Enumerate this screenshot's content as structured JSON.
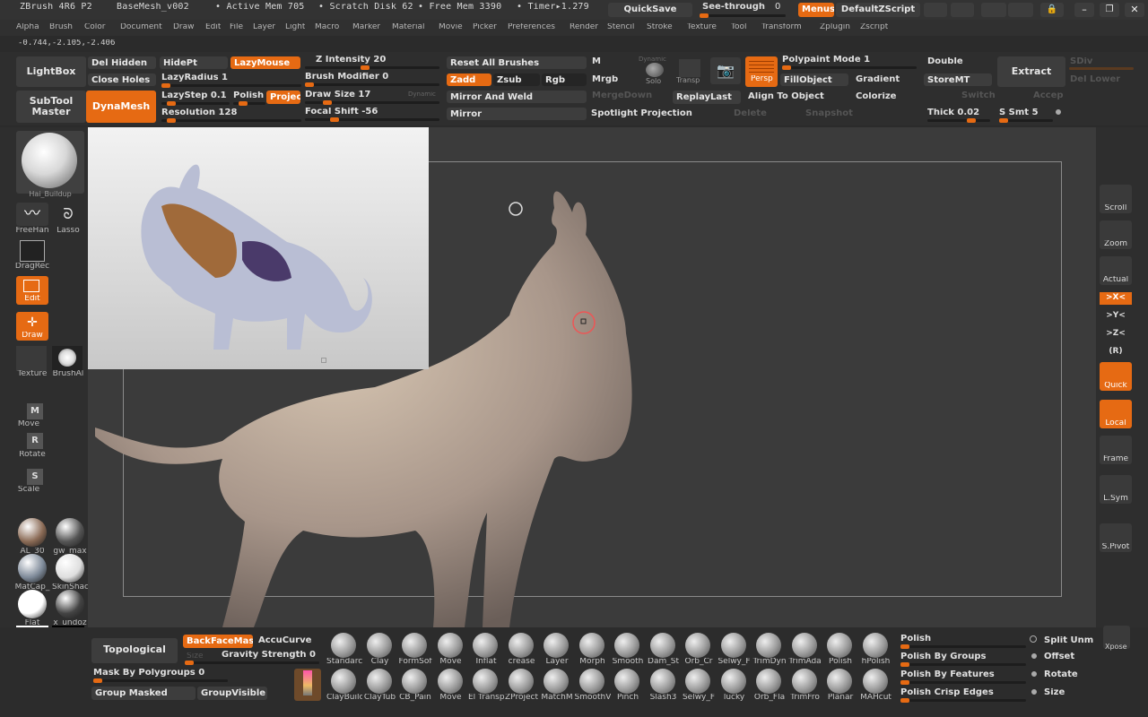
{
  "title_bar": {
    "app": "ZBrush 4R6 P2",
    "doc": "BaseMesh_v002",
    "active_mem": "• Active Mem 705",
    "scratch": "• Scratch Disk 62",
    "free_mem": "• Free Mem 3390",
    "timer": "• Timer▸1.279",
    "quicksave": "QuickSave",
    "see_through": "See-through",
    "see_through_val": "0",
    "menus": "Menus",
    "default_zscript": "DefaultZScript"
  },
  "menu_items": [
    "Alpha",
    "Brush",
    "Color",
    "Document",
    "Draw",
    "Edit",
    "File",
    "Layer",
    "Light",
    "Macro",
    "Marker",
    "Material",
    "Movie",
    "Picker",
    "Preferences",
    "Render",
    "Stencil",
    "Stroke",
    "Texture",
    "Tool",
    "Transform",
    "Zplugin",
    "Zscript"
  ],
  "coords": "-0.744,-2.105,-2.406",
  "toolbar": {
    "lightbox": "LightBox",
    "subtool_master": "SubTool Master",
    "del_hidden": "Del Hidden",
    "close_holes": "Close Holes",
    "dynamesh": "DynaMesh",
    "hidept": "HidePt",
    "lazymouse": "LazyMouse",
    "lazyradius": "LazyRadius 1",
    "lazystep": "LazyStep 0.1",
    "polish": "Polish",
    "project": "Projec",
    "resolution": "Resolution 128",
    "z_intensity": "Z Intensity 20",
    "brush_modifier": "Brush Modifier 0",
    "draw_size": "Draw Size 17",
    "dynamic": "Dynamic",
    "focal_shift": "Focal Shift -56",
    "reset_brushes": "Reset All Brushes",
    "zadd": "Zadd",
    "zsub": "Zsub",
    "rgb": "Rgb",
    "mirror_weld": "Mirror And Weld",
    "mirror": "Mirror",
    "m": "M",
    "mrgb": "Mrgb",
    "solo_dynamic": "Dynamic",
    "solo": "Solo",
    "transp": "Transp",
    "persp": "Persp",
    "mergedown": "MergeDown",
    "replaylast": "ReplayLast",
    "spotlight": "Spotlight Projection",
    "delete": "Delete",
    "snapshot": "Snapshot",
    "polypaint_mode": "Polypaint Mode 1",
    "fillobject": "FillObject",
    "gradient": "Gradient",
    "align_object": "Align To Object",
    "colorize": "Colorize",
    "double": "Double",
    "storemt": "StoreMT",
    "extract": "Extract",
    "switch": "Switch",
    "accept": "Accep",
    "thick": "Thick 0.02",
    "s_smt": "S Smt 5",
    "sdiv": "SDiv",
    "del_lower": "Del Lower"
  },
  "left_shelf": {
    "brush_name": "Hai_Buildup",
    "freehand": "FreeHan",
    "lasso": "Lasso",
    "dragrect": "DragRec",
    "edit": "Edit",
    "draw": "Draw",
    "texture": "Texture",
    "brush_alpha": "BrushAl",
    "move_m": "M",
    "move": "Move",
    "rotate_r": "R",
    "rotate": "Rotate",
    "scale_s": "S",
    "scale": "Scale",
    "materials": [
      {
        "name": "AL_30",
        "color": "#8a6a55"
      },
      {
        "name": "gw_max",
        "color": "#555"
      },
      {
        "name": "MatCap_",
        "color": "#7e8a99"
      },
      {
        "name": "SkinShac",
        "color": "#dedede"
      },
      {
        "name": "Flat",
        "color": "#ffffff"
      },
      {
        "name": "x_undoz",
        "color": "#444"
      }
    ]
  },
  "right_shelf": {
    "scroll": "Scroll",
    "zoom": "Zoom",
    "actual": "Actual",
    "x": ">X<",
    "y": ">Y<",
    "z": ">Z<",
    "r": "(R)",
    "quick": "Quick",
    "local": "Local",
    "frame": "Frame",
    "lsym": "L.Sym",
    "spivot": "S.Pivot",
    "xpose": "Xpose"
  },
  "bottom": {
    "topological": "Topological",
    "backfacemask": "BackFaceMas",
    "accucurve": "AccuCurve",
    "gravity": "Gravity Strength 0",
    "size": "Size",
    "mask_polygroups": "Mask By Polygroups 0",
    "group_masked": "Group Masked",
    "group_visible": "GroupVisible",
    "brushes_row1": [
      "Standarc",
      "Clay",
      "FormSof",
      "Move",
      "Inflat",
      "crease",
      "Layer",
      "Morph",
      "Smooth",
      "Dam_St",
      "Orb_Cr",
      "Selwy_F",
      "TrimDyn",
      "TrimAda",
      "Polish",
      "hPolish"
    ],
    "brushes_row2": [
      "ClayBuilc",
      "ClayTub",
      "CB_Pain",
      "Move",
      "El Transpo",
      "ZProject",
      "MatchM",
      "SmoothV",
      "Pinch",
      "Slash3",
      "Selwy_F",
      "lucky",
      "Orb_Fla",
      "TrimFro",
      "Planar",
      "MAHcut"
    ],
    "polish": "Polish",
    "polish_groups": "Polish By Groups",
    "polish_features": "Polish By Features",
    "polish_crisp": "Polish Crisp Edges",
    "split_unm": "Split Unm",
    "offset": "Offset",
    "rotate": "Rotate",
    "size_r": "Size"
  },
  "colors": {
    "accent": "#e66a13",
    "viewport": "#3b3b3b",
    "panel": "#2e2e2e"
  }
}
